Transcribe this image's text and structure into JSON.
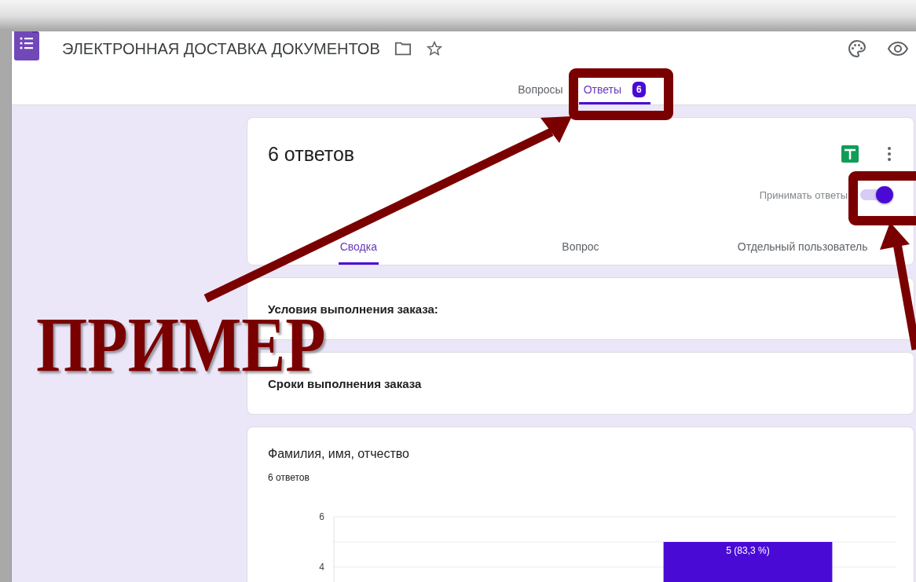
{
  "header": {
    "title": "ЭЛЕКТРОННАЯ ДОСТАВКА ДОКУМЕНТОВ"
  },
  "tabs": [
    {
      "label": "Вопросы",
      "selected": false
    },
    {
      "label": "Ответы",
      "selected": true,
      "badge": "6"
    }
  ],
  "summary": {
    "title": "6 ответов",
    "accepting": {
      "label": "Принимать ответы",
      "on": true
    },
    "subtabs": [
      {
        "label": "Сводка",
        "selected": true
      },
      {
        "label": "Вопрос",
        "selected": false
      },
      {
        "label": "Отдельный пользователь",
        "selected": false
      }
    ]
  },
  "sections": [
    {
      "title": "Условия выполнения заказа:"
    },
    {
      "title": "Сроки выполнения заказа"
    }
  ],
  "question": {
    "title": "Фамилия, имя, отчество",
    "count": "6 ответов",
    "chart_data": {
      "type": "bar",
      "ylim": [
        3.4,
        6
      ],
      "yticks": [
        4,
        6
      ],
      "values": [
        null,
        5
      ],
      "value_labels": [
        null,
        "5 (83,3 %)"
      ]
    }
  },
  "annotation": {
    "label": "ПРИМЕР"
  }
}
